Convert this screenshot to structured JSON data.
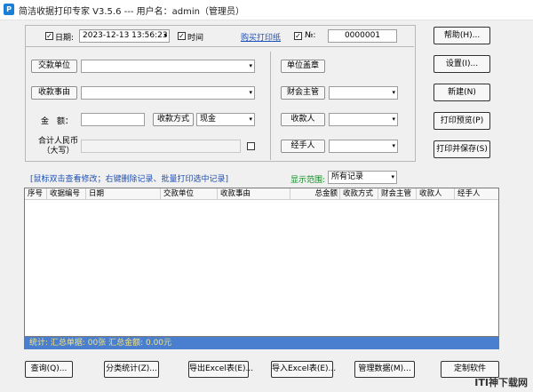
{
  "window": {
    "title": "简洁收据打印专家 V3.5.6 --- 用户名：admin（管理员）",
    "icon_glyph": "P"
  },
  "top": {
    "date_label": "日期:",
    "date_checked": true,
    "date_value": "2023-12-13 13:56:23",
    "time_label": "时间",
    "time_checked": true,
    "buy_link": "购买打印纸",
    "no_label": "№:",
    "no_checked": true,
    "no_value": "0000001"
  },
  "form": {
    "payer_unit_button": "交款单位",
    "payer_unit_value": "",
    "reason_button": "收款事由",
    "reason_value": "",
    "amount_label": "金　额：",
    "amount_value": "",
    "payment_method_button": "收款方式",
    "payment_method_value": "现金",
    "total_rmb_label_line1": "合计人民币",
    "total_rmb_label_line2": "（大写）",
    "total_rmb_value": "",
    "seal_button": "单位盖章",
    "accountant_button": "财会主管",
    "accountant_value": "",
    "receiver_button": "收款人",
    "receiver_value": "",
    "handler_button": "经手人",
    "handler_value": ""
  },
  "side_buttons": {
    "help": "帮助(H)...",
    "settings": "设置(I)...",
    "new": "新建(N)",
    "print_preview": "打印预览(P)",
    "print_save": "打印并保存(S)"
  },
  "list": {
    "hint": "[鼠标双击查看修改；右键删除记录、批量打印选中记录]",
    "range_label": "显示范围:",
    "range_value": "所有记录",
    "columns": [
      "序号",
      "收据编号",
      "日期",
      "交款单位",
      "收款事由",
      "总金额",
      "收款方式",
      "财会主管",
      "收款人",
      "经手人"
    ],
    "rows": []
  },
  "status": {
    "text": "统计:  汇总单据: 00张   汇总金额: 0.00元"
  },
  "bottom_buttons": {
    "query": "查询(Q)...",
    "category_stats": "分类统计(Z)...",
    "export_excel": "导出Excel表(E)...",
    "import_excel": "导入Excel表(E)...",
    "manage_data": "管理数据(M)...",
    "custom_software": "定制软件"
  },
  "watermark": "ITI神下载网",
  "colors": {
    "status_bg": "#4a7fcf",
    "status_text": "#f5e27a",
    "link": "#1d4fb8",
    "range_label": "#0a8a1e"
  },
  "icons": {
    "dropdown": "▾",
    "check": "✓"
  }
}
